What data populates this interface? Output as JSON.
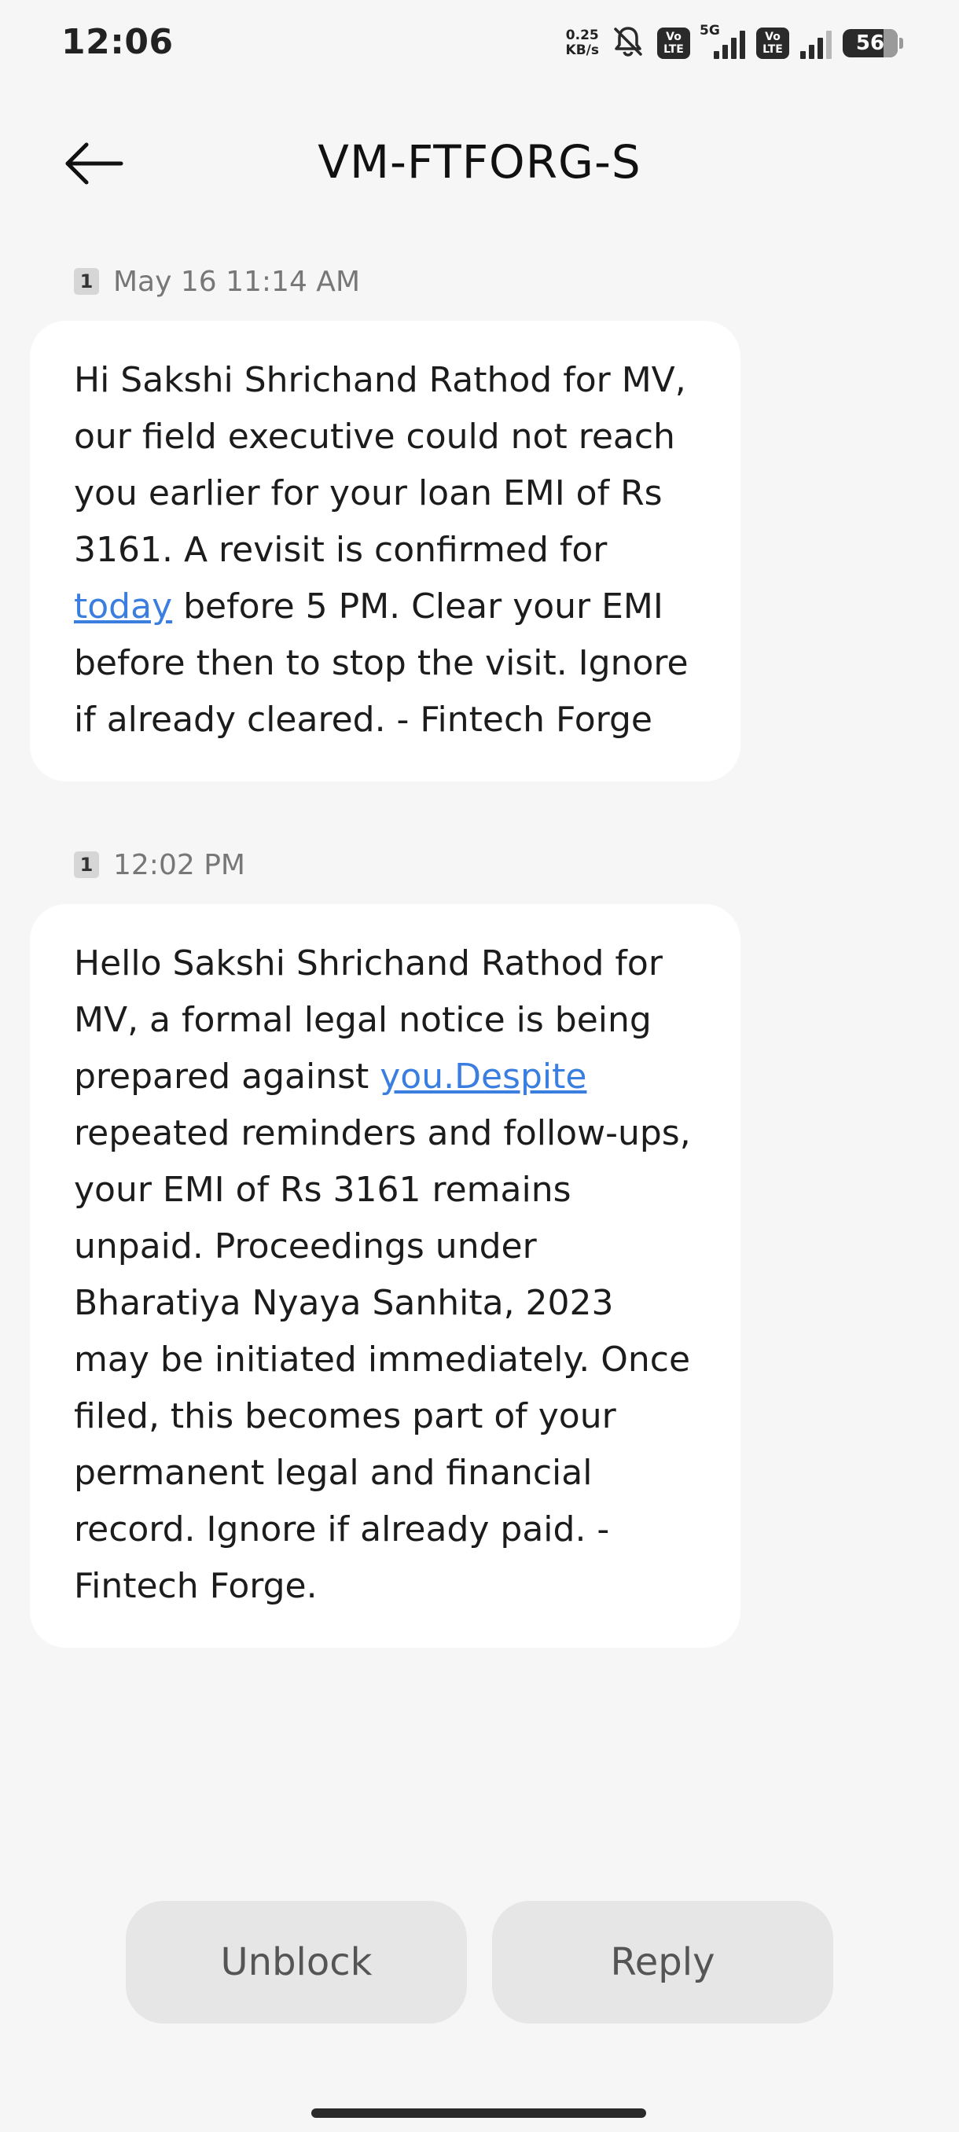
{
  "status_bar": {
    "time": "12:06",
    "net_speed_value": "0.25",
    "net_speed_unit": "KB/s",
    "network_type": "5G",
    "volte_top": "Vo",
    "volte_bottom": "LTE",
    "battery": "56",
    "icons": [
      "mute-bell-icon",
      "volte-icon",
      "signal-icon",
      "battery-icon"
    ]
  },
  "header": {
    "title": "VM-FTFORG-S",
    "back_icon": "arrow-left-icon"
  },
  "messages": [
    {
      "sim": "1",
      "timestamp": "May 16 11:14 AM",
      "text_before_link": "Hi Sakshi Shrichand Rathod for MV, our field executive could not reach you earlier for your loan EMI of Rs 3161. A revisit is confirmed for ",
      "link": "today",
      "text_after_link": " before 5 PM. Clear your EMI before then to stop the visit. Ignore if already cleared. - Fintech Forge"
    },
    {
      "sim": "1",
      "timestamp": "12:02 PM",
      "text_before_link": "Hello Sakshi Shrichand Rathod for MV, a formal legal notice is being prepared against ",
      "link": "you.Despite",
      "text_after_link": " repeated reminders and follow-ups, your EMI of Rs 3161 remains unpaid. Proceedings under Bharatiya Nyaya Sanhita, 2023 may be initiated immediately. Once filed, this becomes part of your permanent legal and financial record. Ignore if already paid. - Fintech Forge."
    }
  ],
  "actions": {
    "unblock_label": "Unblock",
    "reply_label": "Reply"
  },
  "colors": {
    "background": "#f6f6f6",
    "bubble": "#ffffff",
    "link": "#3a7ee0",
    "button": "#e6e6e6"
  }
}
